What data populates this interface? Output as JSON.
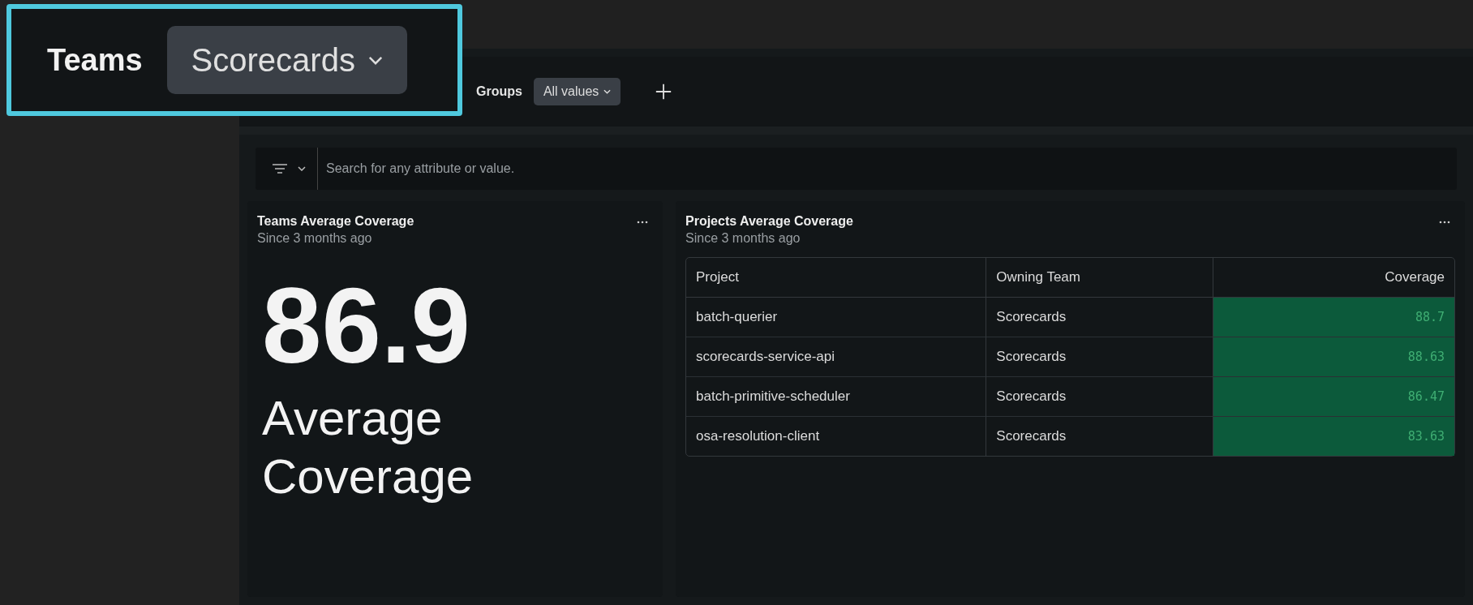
{
  "header": {
    "title": "Teams",
    "team_dropdown": "Scorecards"
  },
  "filters": {
    "groups_label": "Groups",
    "groups_value": "All values"
  },
  "search": {
    "placeholder": "Search for any attribute or value."
  },
  "teams_card": {
    "title": "Teams Average Coverage",
    "subtitle": "Since 3 months ago",
    "value": "86.9",
    "caption": "Average Coverage"
  },
  "projects_card": {
    "title": "Projects Average Coverage",
    "subtitle": "Since 3 months ago",
    "columns": [
      "Project",
      "Owning Team",
      "Coverage"
    ],
    "rows": [
      {
        "project": "batch-querier",
        "team": "Scorecards",
        "coverage": "88.7"
      },
      {
        "project": "scorecards-service-api",
        "team": "Scorecards",
        "coverage": "88.63"
      },
      {
        "project": "batch-primitive-scheduler",
        "team": "Scorecards",
        "coverage": "86.47"
      },
      {
        "project": "osa-resolution-client",
        "team": "Scorecards",
        "coverage": "83.63"
      }
    ]
  }
}
